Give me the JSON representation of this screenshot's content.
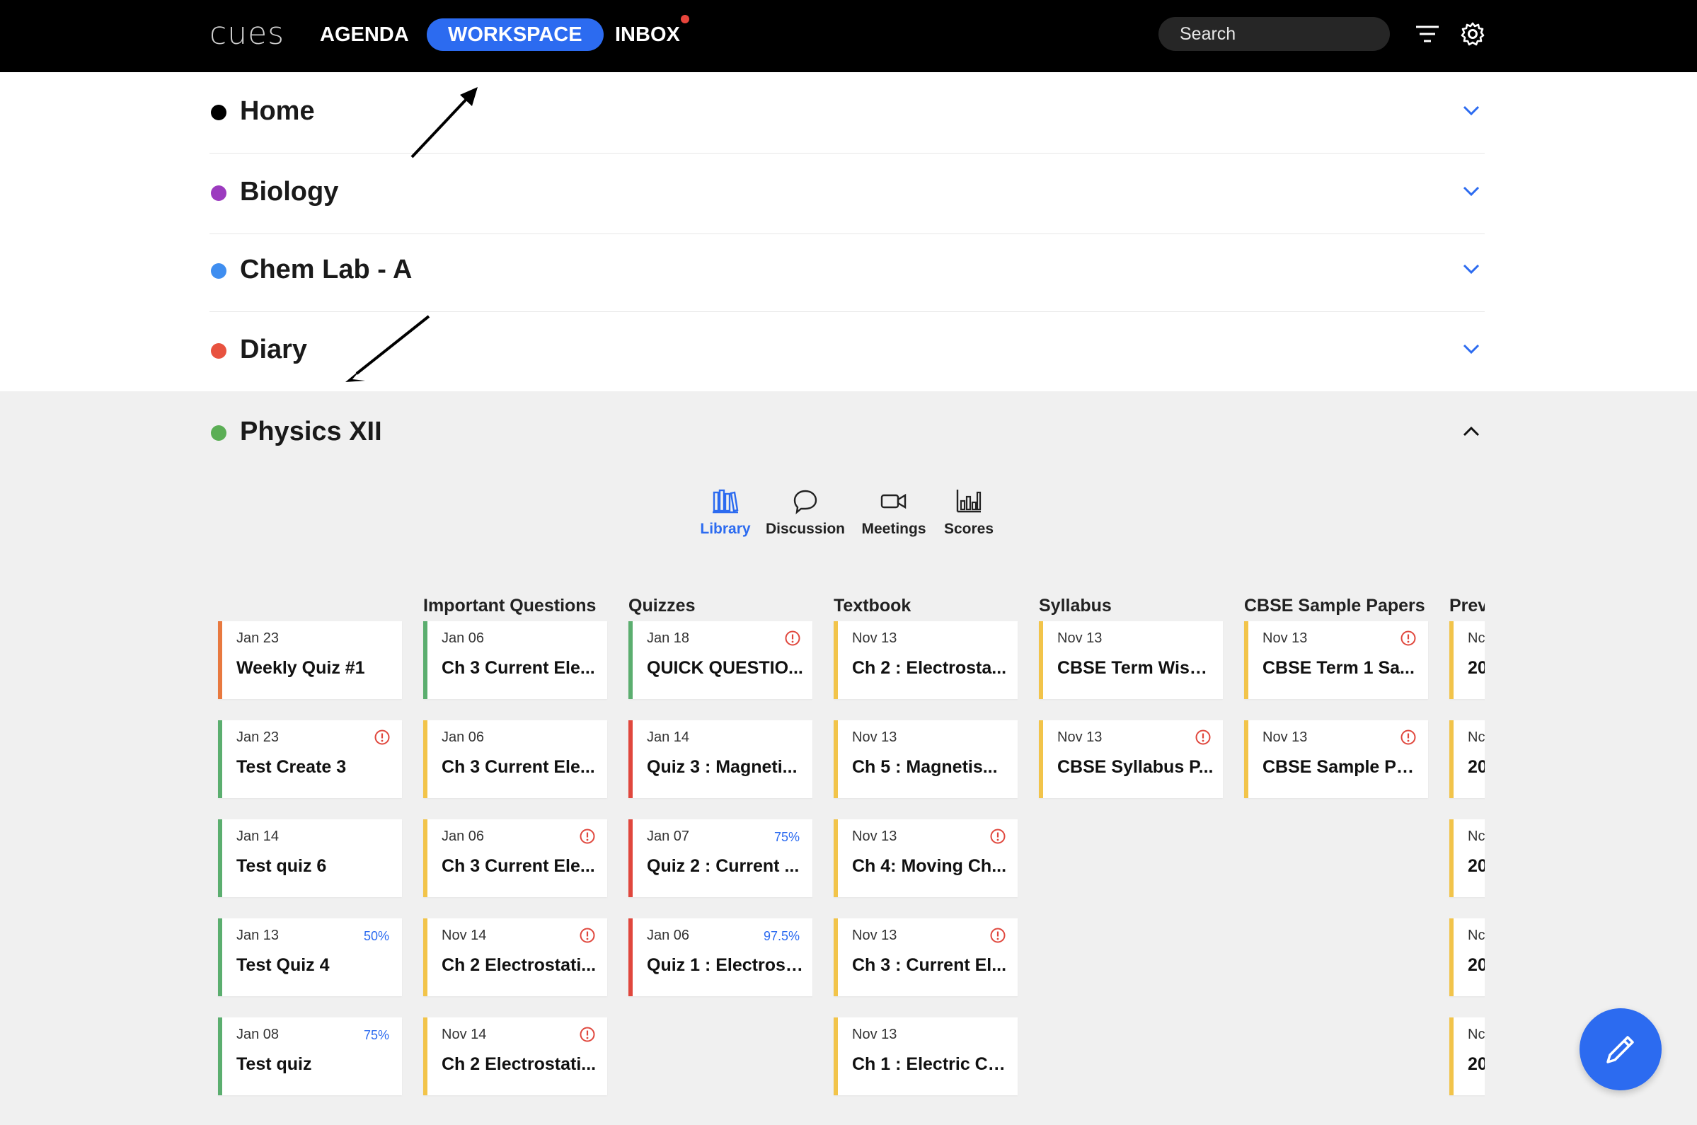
{
  "app": {
    "logo": "cues"
  },
  "nav": {
    "agenda": "AGENDA",
    "workspace": "WORKSPACE",
    "inbox": "INBOX",
    "search_placeholder": "Search",
    "filter_icon": "filter-icon",
    "settings_icon": "gear-icon"
  },
  "sections": [
    {
      "name": "Home",
      "color": "#000000"
    },
    {
      "name": "Biology",
      "color": "#9c3bbf"
    },
    {
      "name": "Chem Lab - A",
      "color": "#3f8ef0"
    },
    {
      "name": "Diary",
      "color": "#e8523f"
    }
  ],
  "expanded": {
    "name": "Physics XII",
    "color": "#5bae55"
  },
  "tabs": [
    {
      "label": "Library",
      "icon": "library-icon",
      "active": true
    },
    {
      "label": "Discussion",
      "icon": "chat-icon"
    },
    {
      "label": "Meetings",
      "icon": "video-icon"
    },
    {
      "label": "Scores",
      "icon": "bar-chart-icon"
    }
  ],
  "columns": [
    {
      "title": "",
      "cards": [
        {
          "date": "Jan 23",
          "title": "Weekly Quiz #1",
          "color": "#e8793f"
        },
        {
          "date": "Jan 23",
          "title": "Test Create 3",
          "color": "#5bae6f",
          "alert": true
        },
        {
          "date": "Jan 14",
          "title": "Test quiz 6",
          "color": "#5bae6f"
        },
        {
          "date": "Jan 13",
          "title": "Test Quiz 4",
          "color": "#5bae6f",
          "badge": "50%"
        },
        {
          "date": "Jan 08",
          "title": "Test quiz",
          "color": "#5bae6f",
          "badge": "75%"
        }
      ]
    },
    {
      "title": "Important Questions",
      "cards": [
        {
          "date": "Jan 06",
          "title": "Ch 3 Current Ele...",
          "color": "#5bae6f"
        },
        {
          "date": "Jan 06",
          "title": "Ch 3 Current Ele...",
          "color": "#f2c44a"
        },
        {
          "date": "Jan 06",
          "title": "Ch 3 Current Ele...",
          "color": "#f2c44a",
          "alert": true
        },
        {
          "date": "Nov 14",
          "title": "Ch 2 Electrostati...",
          "color": "#f2c44a",
          "alert": true
        },
        {
          "date": "Nov 14",
          "title": "Ch 2 Electrostati...",
          "color": "#f2c44a",
          "alert": true
        }
      ]
    },
    {
      "title": "Quizzes",
      "cards": [
        {
          "date": "Jan 18",
          "title": "QUICK QUESTIO...",
          "color": "#5bae6f",
          "alert": true
        },
        {
          "date": "Jan 14",
          "title": "Quiz 3 : Magneti...",
          "color": "#e0473d"
        },
        {
          "date": "Jan 07",
          "title": "Quiz 2 : Current ...",
          "color": "#e0473d",
          "badge": "75%"
        },
        {
          "date": "Jan 06",
          "title": "Quiz 1 : Electrost...",
          "color": "#e0473d",
          "badge": "97.5%"
        }
      ]
    },
    {
      "title": "Textbook",
      "cards": [
        {
          "date": "Nov 13",
          "title": "Ch 2 : Electrosta...",
          "color": "#f2c44a"
        },
        {
          "date": "Nov 13",
          "title": "Ch 5 : Magnetis...",
          "color": "#f2c44a"
        },
        {
          "date": "Nov 13",
          "title": "Ch 4: Moving Ch...",
          "color": "#f2c44a",
          "alert": true
        },
        {
          "date": "Nov 13",
          "title": "Ch 3 : Current El...",
          "color": "#f2c44a",
          "alert": true
        },
        {
          "date": "Nov 13",
          "title": "Ch 1 : Electric Ch...",
          "color": "#f2c44a"
        }
      ]
    },
    {
      "title": "Syllabus",
      "cards": [
        {
          "date": "Nov 13",
          "title": "CBSE Term Wise ...",
          "color": "#f2c44a"
        },
        {
          "date": "Nov 13",
          "title": "CBSE Syllabus P...",
          "color": "#f2c44a",
          "alert": true
        }
      ]
    },
    {
      "title": "CBSE Sample Papers",
      "cards": [
        {
          "date": "Nov 13",
          "title": "CBSE Term 1 Sa...",
          "color": "#f2c44a",
          "alert": true
        },
        {
          "date": "Nov 13",
          "title": "CBSE Sample Pa...",
          "color": "#f2c44a",
          "alert": true
        }
      ]
    },
    {
      "title": "Prev",
      "cards": [
        {
          "date": "Nc",
          "title": "20",
          "color": "#f2c44a"
        },
        {
          "date": "Nc",
          "title": "20",
          "color": "#f2c44a"
        },
        {
          "date": "Nc",
          "title": "20",
          "color": "#f2c44a"
        },
        {
          "date": "Nc",
          "title": "20",
          "color": "#f2c44a"
        },
        {
          "date": "Nc",
          "title": "20",
          "color": "#f2c44a"
        }
      ]
    }
  ],
  "fab": {
    "icon": "pencil-icon"
  }
}
